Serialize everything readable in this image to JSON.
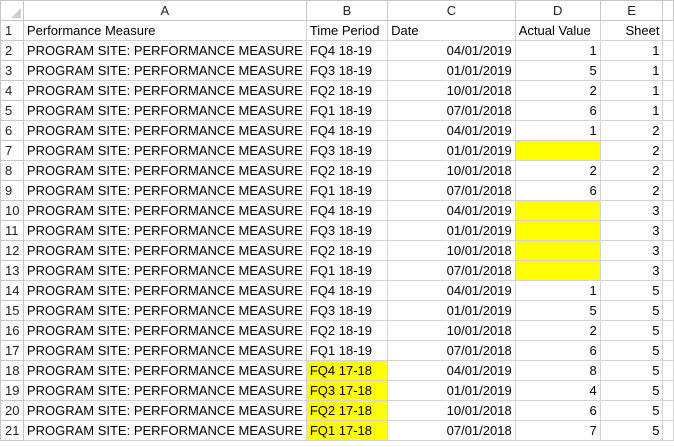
{
  "highlight_color": "#ffff00",
  "columns": [
    "A",
    "B",
    "C",
    "D",
    "E"
  ],
  "rows": [
    {
      "n": "1",
      "cells": [
        "Performance Measure",
        "Time Period",
        "Date",
        "Actual Value",
        "Sheet"
      ],
      "hl": []
    },
    {
      "n": "2",
      "cells": [
        "PROGRAM SITE: PERFORMANCE MEASURE",
        "FQ4 18-19",
        "04/01/2019",
        "1",
        "1"
      ],
      "hl": []
    },
    {
      "n": "3",
      "cells": [
        "PROGRAM SITE: PERFORMANCE MEASURE",
        "FQ3 18-19",
        "01/01/2019",
        "5",
        "1"
      ],
      "hl": []
    },
    {
      "n": "4",
      "cells": [
        "PROGRAM SITE: PERFORMANCE MEASURE",
        "FQ2 18-19",
        "10/01/2018",
        "2",
        "1"
      ],
      "hl": []
    },
    {
      "n": "5",
      "cells": [
        "PROGRAM SITE: PERFORMANCE MEASURE",
        "FQ1 18-19",
        "07/01/2018",
        "6",
        "1"
      ],
      "hl": []
    },
    {
      "n": "6",
      "cells": [
        "PROGRAM SITE: PERFORMANCE MEASURE",
        "FQ4 18-19",
        "04/01/2019",
        "1",
        "2"
      ],
      "hl": []
    },
    {
      "n": "7",
      "cells": [
        "PROGRAM SITE: PERFORMANCE MEASURE",
        "FQ3 18-19",
        "01/01/2019",
        "",
        "2"
      ],
      "hl": [
        3
      ]
    },
    {
      "n": "8",
      "cells": [
        "PROGRAM SITE: PERFORMANCE MEASURE",
        "FQ2 18-19",
        "10/01/2018",
        "2",
        "2"
      ],
      "hl": []
    },
    {
      "n": "9",
      "cells": [
        "PROGRAM SITE: PERFORMANCE MEASURE",
        "FQ1 18-19",
        "07/01/2018",
        "6",
        "2"
      ],
      "hl": []
    },
    {
      "n": "10",
      "cells": [
        "PROGRAM SITE: PERFORMANCE MEASURE",
        "FQ4 18-19",
        "04/01/2019",
        "",
        "3"
      ],
      "hl": [
        3
      ]
    },
    {
      "n": "11",
      "cells": [
        "PROGRAM SITE: PERFORMANCE MEASURE",
        "FQ3 18-19",
        "01/01/2019",
        "",
        "3"
      ],
      "hl": [
        3
      ]
    },
    {
      "n": "12",
      "cells": [
        "PROGRAM SITE: PERFORMANCE MEASURE",
        "FQ2 18-19",
        "10/01/2018",
        "",
        "3"
      ],
      "hl": [
        3
      ]
    },
    {
      "n": "13",
      "cells": [
        "PROGRAM SITE: PERFORMANCE MEASURE",
        "FQ1 18-19",
        "07/01/2018",
        "",
        "3"
      ],
      "hl": [
        3
      ]
    },
    {
      "n": "14",
      "cells": [
        "PROGRAM SITE: PERFORMANCE MEASURE",
        "FQ4 18-19",
        "04/01/2019",
        "1",
        "5"
      ],
      "hl": []
    },
    {
      "n": "15",
      "cells": [
        "PROGRAM SITE: PERFORMANCE MEASURE",
        "FQ3 18-19",
        "01/01/2019",
        "5",
        "5"
      ],
      "hl": []
    },
    {
      "n": "16",
      "cells": [
        "PROGRAM SITE: PERFORMANCE MEASURE",
        "FQ2 18-19",
        "10/01/2018",
        "2",
        "5"
      ],
      "hl": []
    },
    {
      "n": "17",
      "cells": [
        "PROGRAM SITE: PERFORMANCE MEASURE",
        "FQ1 18-19",
        "07/01/2018",
        "6",
        "5"
      ],
      "hl": []
    },
    {
      "n": "18",
      "cells": [
        "PROGRAM SITE: PERFORMANCE MEASURE",
        "FQ4 17-18",
        "04/01/2019",
        "8",
        "5"
      ],
      "hl": [
        1
      ]
    },
    {
      "n": "19",
      "cells": [
        "PROGRAM SITE: PERFORMANCE MEASURE",
        "FQ3 17-18",
        "01/01/2019",
        "4",
        "5"
      ],
      "hl": [
        1
      ]
    },
    {
      "n": "20",
      "cells": [
        "PROGRAM SITE: PERFORMANCE MEASURE",
        "FQ2 17-18",
        "10/01/2018",
        "6",
        "5"
      ],
      "hl": [
        1
      ]
    },
    {
      "n": "21",
      "cells": [
        "PROGRAM SITE: PERFORMANCE MEASURE",
        "FQ1 17-18",
        "07/01/2018",
        "7",
        "5"
      ],
      "hl": [
        1
      ]
    }
  ]
}
